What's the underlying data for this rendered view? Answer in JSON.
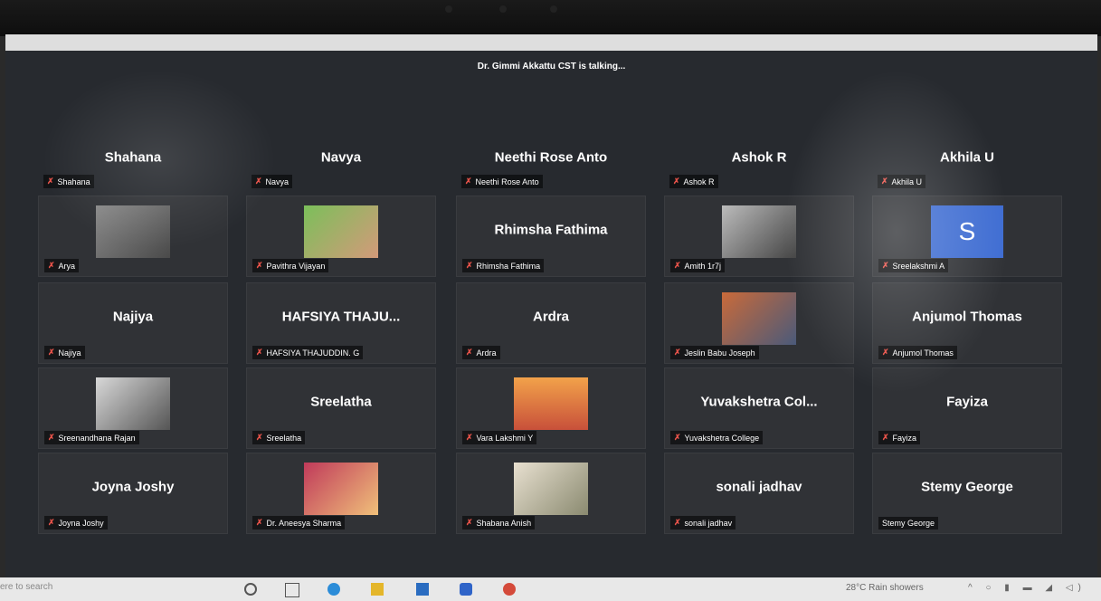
{
  "meeting": {
    "talking_banner": "Dr. Gimmi Akkattu CST is talking..."
  },
  "participants": [
    {
      "display": "Shahana",
      "tag": "Shahana",
      "media": "name"
    },
    {
      "display": "Navya",
      "tag": "Navya",
      "media": "name"
    },
    {
      "display": "Neethi Rose Anto",
      "tag": "Neethi Rose Anto",
      "media": "name"
    },
    {
      "display": "Ashok R",
      "tag": "Ashok R",
      "media": "name"
    },
    {
      "display": "Akhila U",
      "tag": "Akhila U",
      "media": "name"
    },
    {
      "display": "",
      "tag": "Arya",
      "media": "photo"
    },
    {
      "display": "",
      "tag": "Pavithra Vijayan",
      "media": "photo"
    },
    {
      "display": "Rhimsha Fathima",
      "tag": "Rhimsha Fathima",
      "media": "name"
    },
    {
      "display": "",
      "tag": "Amith 1r7j",
      "media": "photo"
    },
    {
      "display": "S",
      "tag": "Sreelakshmi A",
      "media": "avatar"
    },
    {
      "display": "Najiya",
      "tag": "Najiya",
      "media": "name"
    },
    {
      "display": "HAFSIYA THAJU...",
      "tag": "HAFSIYA THAJUDDIN. G",
      "media": "name"
    },
    {
      "display": "Ardra",
      "tag": "Ardra",
      "media": "name"
    },
    {
      "display": "",
      "tag": "Jeslin Babu Joseph",
      "media": "photo"
    },
    {
      "display": "Anjumol Thomas",
      "tag": "Anjumol Thomas",
      "media": "name"
    },
    {
      "display": "",
      "tag": "Sreenandhana Rajan",
      "media": "photo"
    },
    {
      "display": "Sreelatha",
      "tag": "Sreelatha",
      "media": "name"
    },
    {
      "display": "",
      "tag": "Vara Lakshmi Y",
      "media": "photo"
    },
    {
      "display": "Yuvakshetra Col...",
      "tag": "Yuvakshetra College",
      "media": "name"
    },
    {
      "display": "Fayiza",
      "tag": "Fayiza",
      "media": "name"
    },
    {
      "display": "Joyna Joshy",
      "tag": "Joyna Joshy",
      "media": "name"
    },
    {
      "display": "",
      "tag": "Dr. Aneesya Sharma",
      "media": "photo"
    },
    {
      "display": "",
      "tag": "Shabana Anish",
      "media": "photo"
    },
    {
      "display": "sonali jadhav",
      "tag": "sonali jadhav",
      "media": "name"
    },
    {
      "display": "Stemy George",
      "tag": "Stemy George",
      "media": "name"
    }
  ],
  "taskbar": {
    "search_placeholder": "ere to search",
    "weather": "28°C  Rain showers"
  },
  "colors": {
    "mic_muted": "#e8534a",
    "avatar_bg": "#3f6dd2",
    "tile_bg": "#303236"
  }
}
